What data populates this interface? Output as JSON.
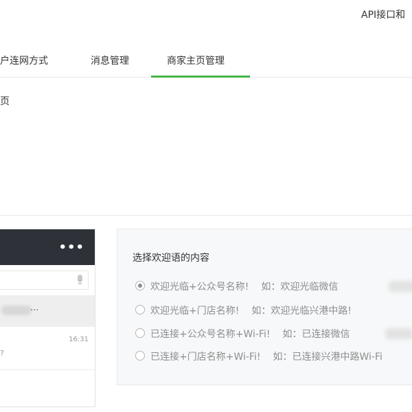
{
  "header": {
    "top_link": "API接口和"
  },
  "tabs": [
    {
      "label": "户连网方式",
      "active": false
    },
    {
      "label": "消息管理",
      "active": false
    },
    {
      "label": "商家主页管理",
      "active": true
    }
  ],
  "accent_color": "#44b549",
  "section": {
    "title": "页"
  },
  "phone": {
    "more_icon": "•••",
    "chat_preview_ellipsis": "...",
    "chat_time": "16:31",
    "chat_fragment": "?",
    "icons": [
      "more-icon",
      "mic-icon"
    ]
  },
  "welcome_panel": {
    "title": "选择欢迎语的内容",
    "selected_index": 0,
    "options": [
      {
        "text": "欢迎光临+公众号名称!",
        "example": "如：欢迎光临微信"
      },
      {
        "text": "欢迎光临+门店名称!",
        "example": "如：欢迎光临兴港中路!"
      },
      {
        "text": "已连接+公众号名称+Wi-Fi!",
        "example": "如：已连接微信"
      },
      {
        "text": "已连接+门店名称+Wi-Fi!",
        "example": "如：已连接兴港中路Wi-Fi"
      }
    ]
  }
}
